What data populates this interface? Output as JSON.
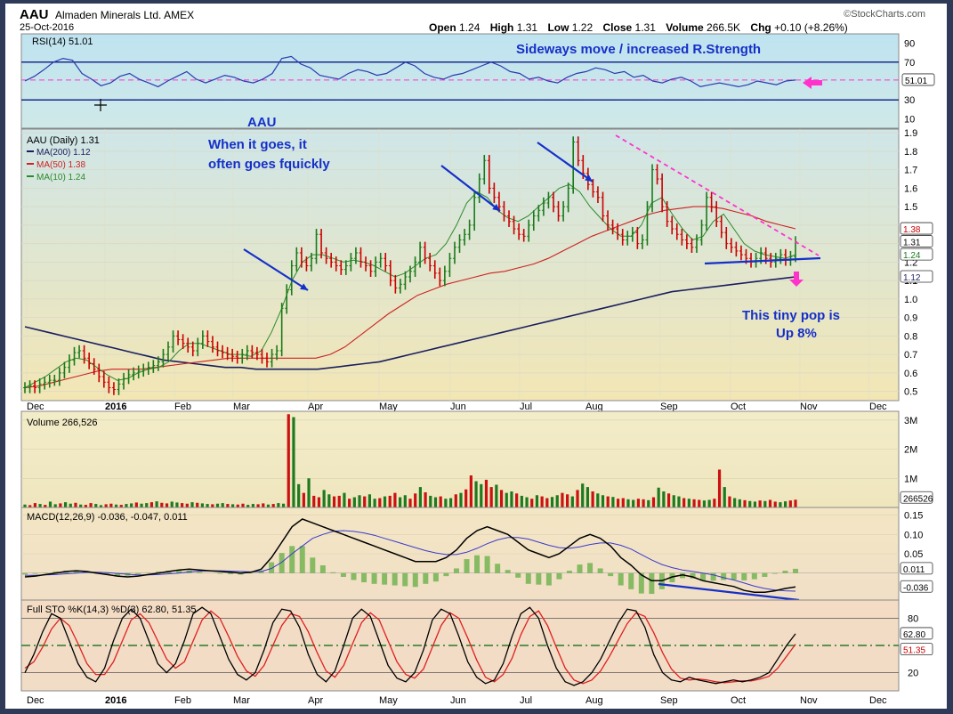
{
  "header": {
    "symbol": "AAU",
    "name": "Almaden Minerals Ltd. AMEX",
    "date": "25-Oct-2016",
    "source": "©StockCharts.com",
    "open_label": "Open",
    "open": "1.24",
    "high_label": "High",
    "high": "1.31",
    "low_label": "Low",
    "low": "1.22",
    "close_label": "Close",
    "close": "1.31",
    "volume_label": "Volume",
    "volume": "266.5K",
    "chg_label": "Chg",
    "chg": "+0.10 (+8.26%)",
    "up_arrow": "▲"
  },
  "colors": {
    "price_up": "#1a7a1a",
    "price_down": "#cc0000",
    "ma200": "#1a1f5e",
    "ma50": "#cc2222",
    "ma10": "#2a8a2a",
    "annotation": "#1530c8",
    "magenta": "#ff33cc",
    "vol_up": "#1e7a1e",
    "vol_down": "#cc1111"
  },
  "chart_data": [
    {
      "type": "line",
      "panel": "rsi",
      "title": "RSI(14) 51.01",
      "ylim": [
        0,
        100
      ],
      "ticks": [
        "90",
        "70",
        "51.01",
        "30",
        "10"
      ],
      "levels": [
        70,
        30
      ],
      "last_value": "51.01",
      "annotation": "Sideways move / increased R.Strength",
      "series": [
        {
          "values": [
            50,
            55,
            62,
            70,
            74,
            72,
            58,
            52,
            45,
            48,
            55,
            58,
            52,
            48,
            44,
            50,
            55,
            60,
            52,
            48,
            52,
            56,
            54,
            50,
            48,
            52,
            58,
            74,
            76,
            68,
            64,
            56,
            54,
            52,
            58,
            62,
            60,
            56,
            58,
            64,
            70,
            66,
            58,
            54,
            52,
            56,
            58,
            62,
            66,
            70,
            66,
            60,
            58,
            52,
            54,
            50,
            48,
            54,
            58,
            60,
            64,
            62,
            58,
            60,
            54,
            56,
            50,
            48,
            52,
            54,
            50,
            44,
            46,
            48,
            46,
            44,
            46,
            50,
            48,
            46,
            50,
            51.01
          ]
        }
      ]
    },
    {
      "type": "line",
      "panel": "price",
      "title": "AAU (Daily) 1.31",
      "x_ticks": [
        "Dec",
        "2016",
        "Feb",
        "Mar",
        "Apr",
        "May",
        "Jun",
        "Jul",
        "Aug",
        "Sep",
        "Oct",
        "Nov",
        "Dec"
      ],
      "y_ticks": [
        "1.9",
        "1.8",
        "1.7",
        "1.6",
        "1.5",
        "1.4",
        "1.3",
        "1.2",
        "1.1",
        "1.0",
        "0.9",
        "0.8",
        "0.7",
        "0.6",
        "0.5"
      ],
      "ylim": [
        0.45,
        1.92
      ],
      "legend": [
        "MA(200) 1.12",
        "MA(50) 1.38",
        "MA(10) 1.24"
      ],
      "price_tags": [
        "1.38",
        "1.31",
        "1.24",
        "1.12"
      ],
      "annotations": [
        "AAU",
        "When it goes, it",
        "often goes fquickly",
        "This tiny pop is",
        "Up 8%"
      ],
      "series": [
        {
          "name": "AAU",
          "values": [
            0.52,
            0.53,
            0.52,
            0.54,
            0.55,
            0.56,
            0.56,
            0.6,
            0.63,
            0.67,
            0.71,
            0.72,
            0.68,
            0.65,
            0.62,
            0.58,
            0.55,
            0.52,
            0.51,
            0.54,
            0.57,
            0.59,
            0.6,
            0.61,
            0.62,
            0.63,
            0.64,
            0.66,
            0.7,
            0.74,
            0.8,
            0.78,
            0.76,
            0.74,
            0.72,
            0.76,
            0.8,
            0.77,
            0.74,
            0.72,
            0.71,
            0.7,
            0.69,
            0.68,
            0.7,
            0.72,
            0.71,
            0.7,
            0.68,
            0.66,
            0.7,
            0.72,
            0.95,
            1.05,
            1.18,
            1.25,
            1.2,
            1.18,
            1.22,
            1.35,
            1.25,
            1.22,
            1.2,
            1.18,
            1.16,
            1.18,
            1.22,
            1.25,
            1.2,
            1.18,
            1.15,
            1.2,
            1.22,
            1.18,
            1.1,
            1.06,
            1.08,
            1.12,
            1.15,
            1.2,
            1.28,
            1.22,
            1.18,
            1.14,
            1.1,
            1.15,
            1.22,
            1.28,
            1.32,
            1.35,
            1.4,
            1.55,
            1.65,
            1.75,
            1.6,
            1.55,
            1.5,
            1.45,
            1.42,
            1.38,
            1.35,
            1.34,
            1.4,
            1.45,
            1.48,
            1.52,
            1.55,
            1.5,
            1.45,
            1.5,
            1.6,
            1.85,
            1.75,
            1.68,
            1.62,
            1.58,
            1.55,
            1.45,
            1.4,
            1.38,
            1.35,
            1.32,
            1.34,
            1.36,
            1.3,
            1.32,
            1.5,
            1.7,
            1.65,
            1.5,
            1.42,
            1.38,
            1.35,
            1.32,
            1.3,
            1.28,
            1.32,
            1.4,
            1.55,
            1.5,
            1.42,
            1.36,
            1.3,
            1.28,
            1.26,
            1.24,
            1.22,
            1.2,
            1.22,
            1.25,
            1.22,
            1.2,
            1.22,
            1.24,
            1.21,
            1.23,
            1.31
          ]
        },
        {
          "name": "MA(200)",
          "values": [
            0.85,
            0.83,
            0.81,
            0.79,
            0.77,
            0.75,
            0.73,
            0.71,
            0.69,
            0.67,
            0.66,
            0.65,
            0.64,
            0.63,
            0.63,
            0.62,
            0.62,
            0.62,
            0.62,
            0.62,
            0.63,
            0.64,
            0.65,
            0.66,
            0.68,
            0.7,
            0.72,
            0.74,
            0.76,
            0.78,
            0.8,
            0.82,
            0.84,
            0.86,
            0.88,
            0.9,
            0.92,
            0.94,
            0.96,
            0.98,
            1.0,
            1.02,
            1.04,
            1.05,
            1.06,
            1.07,
            1.08,
            1.09,
            1.1,
            1.11,
            1.12
          ]
        },
        {
          "name": "MA(50)",
          "values": [
            0.52,
            0.53,
            0.55,
            0.57,
            0.59,
            0.61,
            0.62,
            0.62,
            0.62,
            0.63,
            0.64,
            0.65,
            0.66,
            0.67,
            0.68,
            0.68,
            0.68,
            0.68,
            0.68,
            0.68,
            0.68,
            0.7,
            0.74,
            0.8,
            0.86,
            0.92,
            0.97,
            1.02,
            1.05,
            1.08,
            1.1,
            1.12,
            1.14,
            1.15,
            1.17,
            1.19,
            1.22,
            1.26,
            1.3,
            1.34,
            1.37,
            1.4,
            1.43,
            1.46,
            1.48,
            1.49,
            1.5,
            1.5,
            1.49,
            1.47,
            1.45,
            1.42,
            1.4,
            1.38
          ]
        },
        {
          "name": "MA(10)",
          "values": [
            0.52,
            0.55,
            0.58,
            0.62,
            0.66,
            0.68,
            0.67,
            0.63,
            0.59,
            0.56,
            0.57,
            0.6,
            0.62,
            0.63,
            0.66,
            0.72,
            0.76,
            0.76,
            0.74,
            0.72,
            0.7,
            0.7,
            0.69,
            0.72,
            0.82,
            0.95,
            1.1,
            1.2,
            1.24,
            1.24,
            1.22,
            1.2,
            1.21,
            1.2,
            1.18,
            1.15,
            1.12,
            1.14,
            1.18,
            1.22,
            1.24,
            1.3,
            1.4,
            1.52,
            1.58,
            1.55,
            1.48,
            1.44,
            1.42,
            1.45,
            1.5,
            1.55,
            1.6,
            1.62,
            1.58,
            1.5,
            1.44,
            1.38,
            1.34,
            1.34,
            1.4,
            1.52,
            1.55,
            1.46,
            1.38,
            1.32,
            1.34,
            1.42,
            1.46,
            1.38,
            1.3,
            1.26,
            1.24,
            1.23,
            1.22,
            1.24
          ]
        }
      ]
    },
    {
      "type": "bar",
      "panel": "volume",
      "title": "Volume 266,526",
      "y_ticks": [
        "3M",
        "2M",
        "1M",
        "266526"
      ],
      "ylim": [
        0,
        3300000
      ],
      "values": [
        100000,
        80000,
        150000,
        120000,
        90000,
        200000,
        110000,
        140000,
        180000,
        130000,
        160000,
        100000,
        90000,
        150000,
        120000,
        80000,
        110000,
        130000,
        100000,
        90000,
        120000,
        140000,
        170000,
        130000,
        150000,
        180000,
        210000,
        160000,
        140000,
        200000,
        170000,
        150000,
        130000,
        180000,
        160000,
        140000,
        120000,
        110000,
        130000,
        150000,
        120000,
        110000,
        100000,
        130000,
        90000,
        120000,
        110000,
        140000,
        100000,
        120000,
        150000,
        130000,
        3200000,
        3100000,
        800000,
        500000,
        1000000,
        400000,
        350000,
        600000,
        450000,
        380000,
        400000,
        500000,
        300000,
        350000,
        420000,
        380000,
        450000,
        300000,
        320000,
        380000,
        400000,
        500000,
        350000,
        420000,
        300000,
        480000,
        700000,
        520000,
        400000,
        350000,
        380000,
        300000,
        320000,
        450000,
        500000,
        620000,
        1100000,
        900000,
        800000,
        950000,
        700000,
        780000,
        600000,
        500000,
        550000,
        480000,
        400000,
        350000,
        300000,
        420000,
        380000,
        320000,
        360000,
        420000,
        500000,
        450000,
        380000,
        600000,
        820000,
        700000,
        550000,
        480000,
        420000,
        380000,
        360000,
        300000,
        320000,
        280000,
        260000,
        300000,
        280000,
        250000,
        350000,
        680000,
        550000,
        480000,
        420000,
        380000,
        320000,
        300000,
        280000,
        260000,
        240000,
        260000,
        300000,
        1300000,
        700000,
        380000,
        320000,
        280000,
        250000,
        220000,
        200000,
        240000,
        220000,
        260000,
        200000,
        180000,
        210000,
        240000,
        266526
      ]
    },
    {
      "type": "line",
      "panel": "macd",
      "title": "MACD(12,26,9) -0.036, -0.047, 0.011",
      "y_ticks": [
        "0.15",
        "0.10",
        "0.05",
        "0.011",
        "-0.036"
      ],
      "ylim": [
        -0.07,
        0.17
      ],
      "series": [
        {
          "name": "MACD",
          "values": [
            -0.01,
            -0.008,
            -0.004,
            0.0,
            0.004,
            0.006,
            0.004,
            0.0,
            -0.004,
            -0.008,
            -0.01,
            -0.008,
            -0.004,
            0.0,
            0.004,
            0.008,
            0.01,
            0.008,
            0.006,
            0.004,
            0.002,
            0.0,
            0.002,
            0.01,
            0.04,
            0.08,
            0.12,
            0.14,
            0.13,
            0.12,
            0.11,
            0.1,
            0.09,
            0.08,
            0.07,
            0.06,
            0.05,
            0.04,
            0.03,
            0.03,
            0.03,
            0.04,
            0.06,
            0.09,
            0.11,
            0.12,
            0.11,
            0.1,
            0.08,
            0.06,
            0.05,
            0.04,
            0.05,
            0.07,
            0.09,
            0.1,
            0.09,
            0.07,
            0.04,
            0.02,
            -0.005,
            -0.02,
            -0.02,
            -0.01,
            -0.005,
            -0.01,
            -0.02,
            -0.025,
            -0.03,
            -0.035,
            -0.045,
            -0.05,
            -0.05,
            -0.046,
            -0.04,
            -0.036
          ]
        },
        {
          "name": "Signal",
          "values": [
            -0.006,
            -0.006,
            -0.005,
            -0.004,
            -0.002,
            0.0,
            0.002,
            0.002,
            0.001,
            -0.001,
            -0.003,
            -0.005,
            -0.005,
            -0.004,
            -0.002,
            0.0,
            0.003,
            0.005,
            0.006,
            0.006,
            0.005,
            0.004,
            0.003,
            0.004,
            0.012,
            0.028,
            0.05,
            0.07,
            0.09,
            0.1,
            0.108,
            0.11,
            0.108,
            0.104,
            0.098,
            0.09,
            0.082,
            0.074,
            0.066,
            0.058,
            0.052,
            0.048,
            0.048,
            0.054,
            0.064,
            0.076,
            0.086,
            0.092,
            0.092,
            0.088,
            0.08,
            0.072,
            0.066,
            0.064,
            0.068,
            0.074,
            0.078,
            0.078,
            0.072,
            0.062,
            0.048,
            0.034,
            0.022,
            0.014,
            0.008,
            0.004,
            0.0,
            -0.005,
            -0.012,
            -0.018,
            -0.026,
            -0.034,
            -0.04,
            -0.044,
            -0.046,
            -0.047
          ]
        }
      ]
    },
    {
      "type": "line",
      "panel": "stochastic",
      "title": "Full STO %K(14,3) %D(3) 62.80, 51.35",
      "y_ticks": [
        "80",
        "62.80",
        "51.35",
        "20"
      ],
      "ylim": [
        0,
        100
      ],
      "levels": [
        80,
        50,
        20
      ],
      "series": [
        {
          "name": "%K",
          "values": [
            20,
            40,
            65,
            85,
            80,
            55,
            30,
            15,
            10,
            25,
            55,
            80,
            90,
            80,
            55,
            30,
            20,
            30,
            55,
            85,
            92,
            85,
            60,
            35,
            18,
            12,
            20,
            45,
            75,
            90,
            88,
            70,
            40,
            18,
            10,
            22,
            50,
            80,
            90,
            82,
            55,
            28,
            14,
            10,
            20,
            45,
            78,
            90,
            85,
            60,
            32,
            15,
            8,
            12,
            30,
            60,
            85,
            92,
            80,
            50,
            25,
            10,
            6,
            10,
            20,
            35,
            55,
            75,
            90,
            88,
            70,
            40,
            20,
            12,
            10,
            15,
            12,
            10,
            8,
            10,
            12,
            10,
            12,
            15,
            20,
            35,
            50,
            62.8
          ]
        },
        {
          "name": "%D",
          "values": [
            25,
            32,
            48,
            68,
            80,
            72,
            52,
            30,
            18,
            18,
            32,
            55,
            78,
            85,
            75,
            55,
            35,
            25,
            32,
            55,
            78,
            88,
            80,
            60,
            38,
            22,
            16,
            28,
            50,
            72,
            85,
            82,
            65,
            42,
            22,
            15,
            28,
            52,
            75,
            86,
            78,
            55,
            32,
            18,
            14,
            24,
            48,
            72,
            86,
            80,
            58,
            34,
            15,
            10,
            18,
            36,
            62,
            82,
            88,
            72,
            48,
            25,
            12,
            8,
            12,
            22,
            38,
            56,
            74,
            86,
            82,
            64,
            42,
            24,
            14,
            12,
            13,
            12,
            10,
            9,
            10,
            11,
            11,
            13,
            16,
            25,
            38,
            51.35
          ]
        }
      ]
    }
  ]
}
